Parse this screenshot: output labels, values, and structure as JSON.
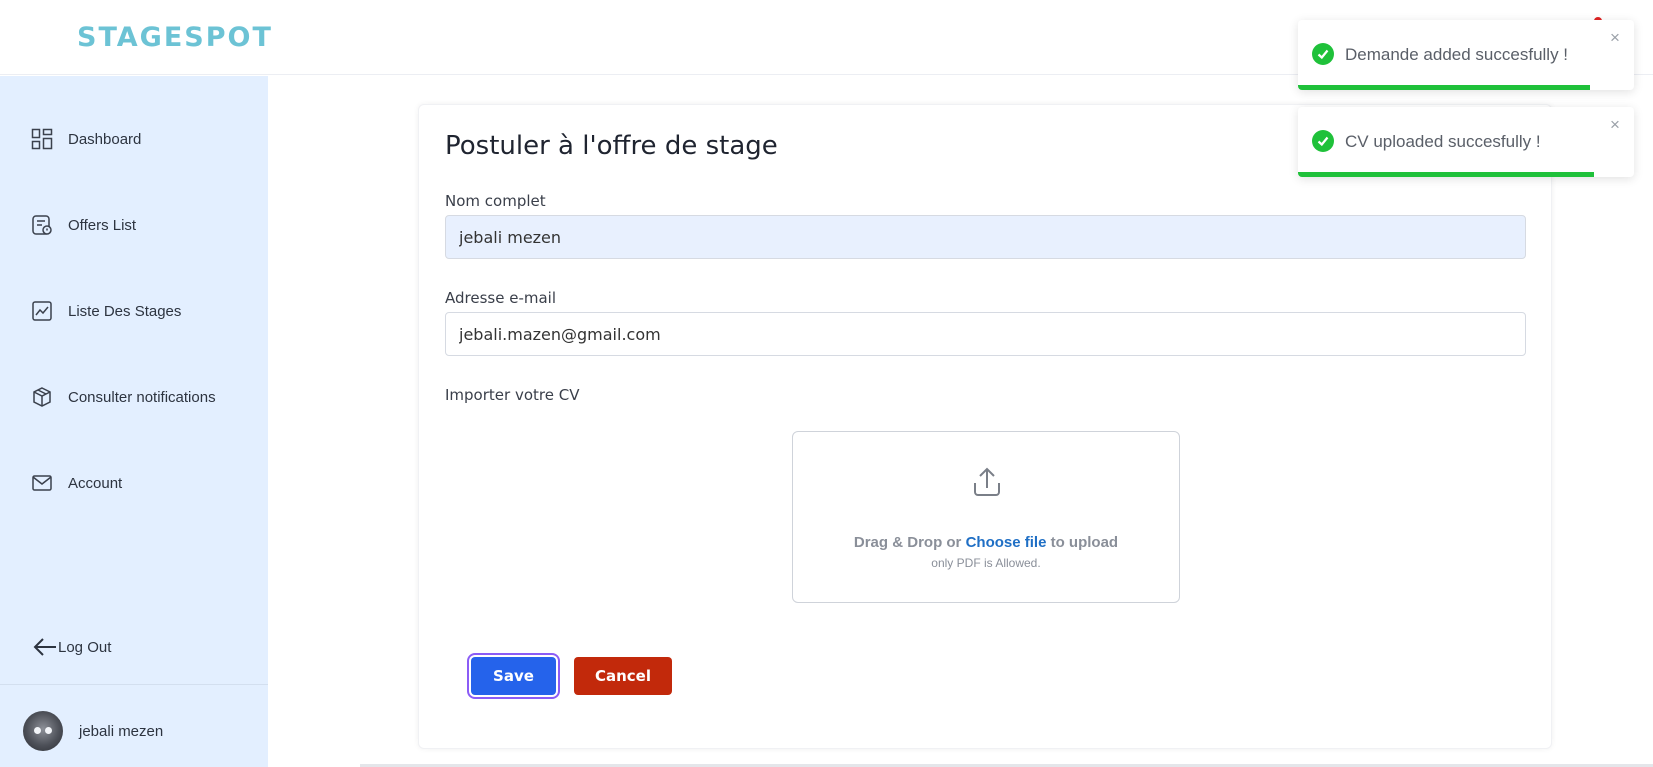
{
  "app": {
    "logo_text": "STAGESPOT"
  },
  "sidebar": {
    "items": [
      {
        "label": "Dashboard",
        "icon": "dashboard-grid-icon"
      },
      {
        "label": "Offers List",
        "icon": "document-list-icon"
      },
      {
        "label": "Liste Des Stages",
        "icon": "trend-chart-icon"
      },
      {
        "label": "Consulter notifications",
        "icon": "cube-icon"
      },
      {
        "label": "Account",
        "icon": "envelope-icon"
      }
    ],
    "logout_label": "Log Out",
    "user_name": "jebali mezen"
  },
  "form": {
    "title": "Postuler à l'offre de stage",
    "name_label": "Nom complet",
    "name_value": "jebali mezen",
    "email_label": "Adresse e-mail",
    "email_value": "jebali.mazen@gmail.com",
    "cv_label": "Importer votre CV",
    "dropzone": {
      "text_before": "Drag & Drop or ",
      "choose_link": "Choose file",
      "text_after": " to upload",
      "hint": "only PDF is Allowed."
    },
    "save_label": "Save",
    "cancel_label": "Cancel"
  },
  "toasts": [
    {
      "message": "Demande added succesfully !",
      "close": "×",
      "progress": 0.87
    },
    {
      "message": "CV uploaded succesfully !",
      "close": "×",
      "progress": 0.88
    }
  ],
  "colors": {
    "accent": "#2563eb",
    "danger": "#c2290b",
    "success": "#1fc13a",
    "sidebar_bg": "#e3efff",
    "logo": "#6cc3d5"
  }
}
